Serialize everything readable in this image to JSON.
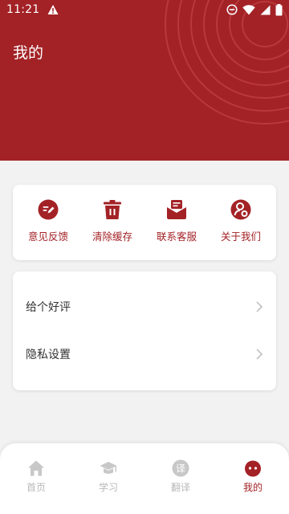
{
  "status_bar": {
    "time": "11:21"
  },
  "header": {
    "title": "我的"
  },
  "actions": [
    {
      "label": "意见反馈",
      "icon": "feedback-icon"
    },
    {
      "label": "清除缓存",
      "icon": "trash-icon"
    },
    {
      "label": "联系客服",
      "icon": "mail-icon"
    },
    {
      "label": "关于我们",
      "icon": "about-icon"
    }
  ],
  "list": [
    {
      "label": "给个好评"
    },
    {
      "label": "隐私设置"
    }
  ],
  "nav": [
    {
      "label": "首页",
      "icon": "home-icon",
      "active": false
    },
    {
      "label": "学习",
      "icon": "graduation-cap-icon",
      "active": false
    },
    {
      "label": "翻译",
      "icon": "translate-icon",
      "active": false
    },
    {
      "label": "我的",
      "icon": "profile-icon",
      "active": true
    }
  ],
  "colors": {
    "primary": "#a32226",
    "inactive": "#b9b9b9",
    "background": "#f2f2f2"
  }
}
